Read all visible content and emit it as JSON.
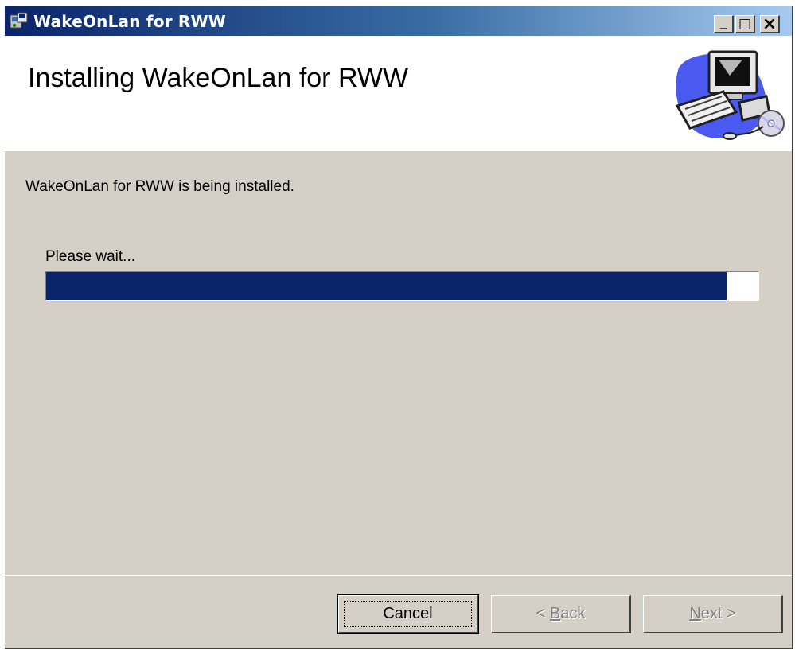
{
  "window": {
    "title": "WakeOnLan for RWW",
    "title_icon": "installer-icon",
    "controls": {
      "minimize": "_",
      "maximize": "□",
      "close": "×"
    }
  },
  "header": {
    "title": "Installing WakeOnLan for RWW",
    "graphic": "computer-with-disc-graphic"
  },
  "body": {
    "status_text": "WakeOnLan for RWW is being installed.",
    "wait_label": "Please wait...",
    "progress_fraction": 0.955
  },
  "buttons": {
    "cancel": "Cancel",
    "back_prefix": "< ",
    "back_access": "B",
    "back_rest": "ack",
    "next_access": "N",
    "next_rest": "ext >"
  },
  "colors": {
    "titlebar_start": "#0a246a",
    "titlebar_end": "#a6caf0",
    "progress_fill": "#0a246a",
    "face": "#d4d0c8"
  }
}
